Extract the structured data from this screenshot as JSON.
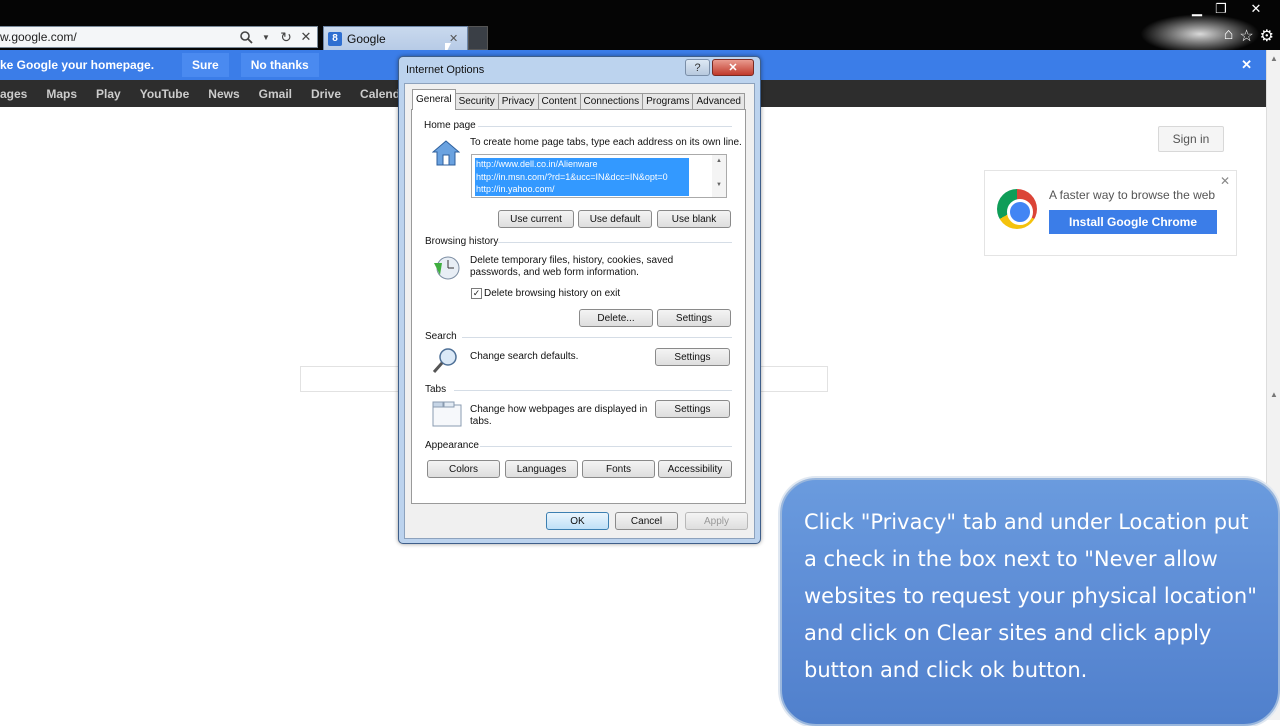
{
  "browser": {
    "address": "w.google.com/",
    "tab_title": "Google",
    "tab_favicon": "8",
    "colors": {
      "chrome": "#050505",
      "accent": "#3b7de8"
    }
  },
  "notification": {
    "message": "ke Google your homepage.",
    "sure": "Sure",
    "no_thanks": "No thanks"
  },
  "google_nav": [
    "ages",
    "Maps",
    "Play",
    "YouTube",
    "News",
    "Gmail",
    "Drive",
    "Calend"
  ],
  "google_page": {
    "sign_in": "Sign in",
    "promo_text": "A faster way to browse the web",
    "promo_button": "Install Google Chrome"
  },
  "dialog": {
    "title": "Internet Options",
    "help": "?",
    "close": "✕",
    "tabs": [
      "General",
      "Security",
      "Privacy",
      "Content",
      "Connections",
      "Programs",
      "Advanced"
    ],
    "home_page": {
      "heading": "Home page",
      "hint": "To create home page tabs, type each address on its own line.",
      "urls": [
        "http://www.dell.co.in/Alienware",
        "http://in.msn.com/?rd=1&ucc=IN&dcc=IN&opt=0",
        "http://in.yahoo.com/"
      ],
      "use_current": "Use current",
      "use_default": "Use default",
      "use_blank": "Use blank"
    },
    "history": {
      "heading": "Browsing history",
      "description": "Delete temporary files, history, cookies, saved passwords, and web form information.",
      "checkbox_label": "Delete browsing history on exit",
      "checked": true,
      "delete": "Delete...",
      "settings": "Settings"
    },
    "search": {
      "heading": "Search",
      "description": "Change search defaults.",
      "settings": "Settings"
    },
    "tabs_section": {
      "heading": "Tabs",
      "description": "Change how webpages are displayed in tabs.",
      "settings": "Settings"
    },
    "appearance": {
      "heading": "Appearance",
      "colors": "Colors",
      "languages": "Languages",
      "fonts": "Fonts",
      "accessibility": "Accessibility"
    },
    "ok": "OK",
    "cancel": "Cancel",
    "apply": "Apply"
  },
  "callout": {
    "text": "Click \"Privacy\" tab and under Location put a check in the box next to \"Never allow websites to request your physical location\" and click on Clear sites and click apply button and click ok button."
  }
}
